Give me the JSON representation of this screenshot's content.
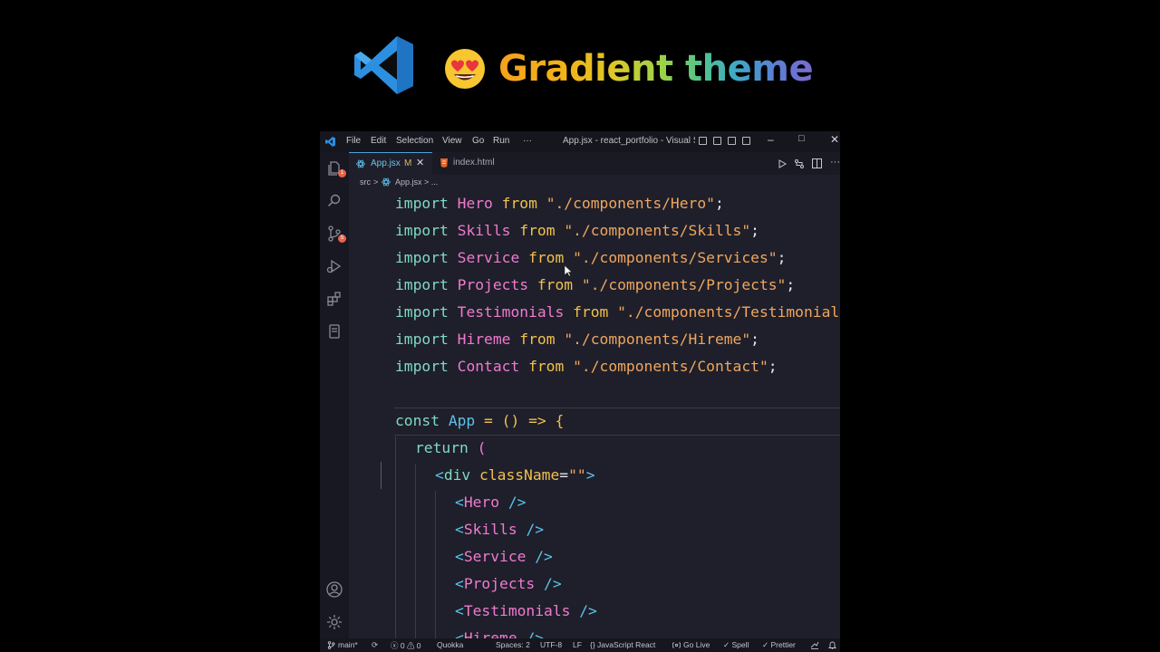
{
  "banner": {
    "headline": "Gradient theme"
  },
  "window": {
    "title": "App.jsx - react_portfolio - Visual St...",
    "menu": [
      "File",
      "Edit",
      "Selection",
      "View",
      "Go",
      "Run",
      "···"
    ],
    "controls": {
      "minimize": "–",
      "maximize": "□",
      "close": "✕"
    }
  },
  "activity_bar": {
    "explorer_badge": "1",
    "scm_badge": "5"
  },
  "tabs": [
    {
      "label": "App.jsx",
      "modified": "M",
      "close": "✕",
      "active": true
    },
    {
      "label": "index.html",
      "active": false
    }
  ],
  "tab_actions": {
    "more": "···"
  },
  "breadcrumb": {
    "folder": "src",
    "sep": ">",
    "file": "App.jsx",
    "tail": "> ..."
  },
  "code": {
    "imports": [
      {
        "kw": "import",
        "name": "Hero",
        "from": "from",
        "path": "\"./components/Hero\"",
        "end": ";"
      },
      {
        "kw": "import",
        "name": "Skills",
        "from": "from",
        "path": "\"./components/Skills\"",
        "end": ";"
      },
      {
        "kw": "import",
        "name": "Service",
        "from": "from",
        "path": "\"./components/Services\"",
        "end": ";"
      },
      {
        "kw": "import",
        "name": "Projects",
        "from": "from",
        "path": "\"./components/Projects\"",
        "end": ";"
      },
      {
        "kw": "import",
        "name": "Testimonials",
        "from": "from",
        "path": "\"./components/Testimonials\"",
        "end": ";"
      },
      {
        "kw": "import",
        "name": "Hireme",
        "from": "from",
        "path": "\"./components/Hireme\"",
        "end": ";"
      },
      {
        "kw": "import",
        "name": "Contact",
        "from": "from",
        "path": "\"./components/Contact\"",
        "end": ";"
      }
    ],
    "const_line": {
      "kw": "const",
      "name": "App",
      "rest": " = () => {"
    },
    "return_line": {
      "kw": "return",
      "rest": " ("
    },
    "div_line": {
      "open": "<",
      "tag": "div",
      "attr": "className",
      "eq": "=",
      "val": "\"\"",
      "close": ">"
    },
    "components": [
      {
        "open": "<",
        "name": "Hero",
        "close": " />"
      },
      {
        "open": "<",
        "name": "Skills",
        "close": " />"
      },
      {
        "open": "<",
        "name": "Service",
        "close": " />"
      },
      {
        "open": "<",
        "name": "Projects",
        "close": " />"
      },
      {
        "open": "<",
        "name": "Testimonials",
        "close": " />"
      },
      {
        "open": "<",
        "name": "Hireme",
        "close": " />"
      }
    ]
  },
  "status_bar": {
    "branch": "main*",
    "sync": "⟳",
    "problems": "ⓧ 0 ⚠ 0",
    "quokka": "Quokka",
    "spaces": "Spaces: 2",
    "encoding": "UTF-8",
    "eol": "LF",
    "language": "{} JavaScript React",
    "golive": "Go Live",
    "spell": "✓ Spell",
    "prettier": "✓ Prettier"
  }
}
